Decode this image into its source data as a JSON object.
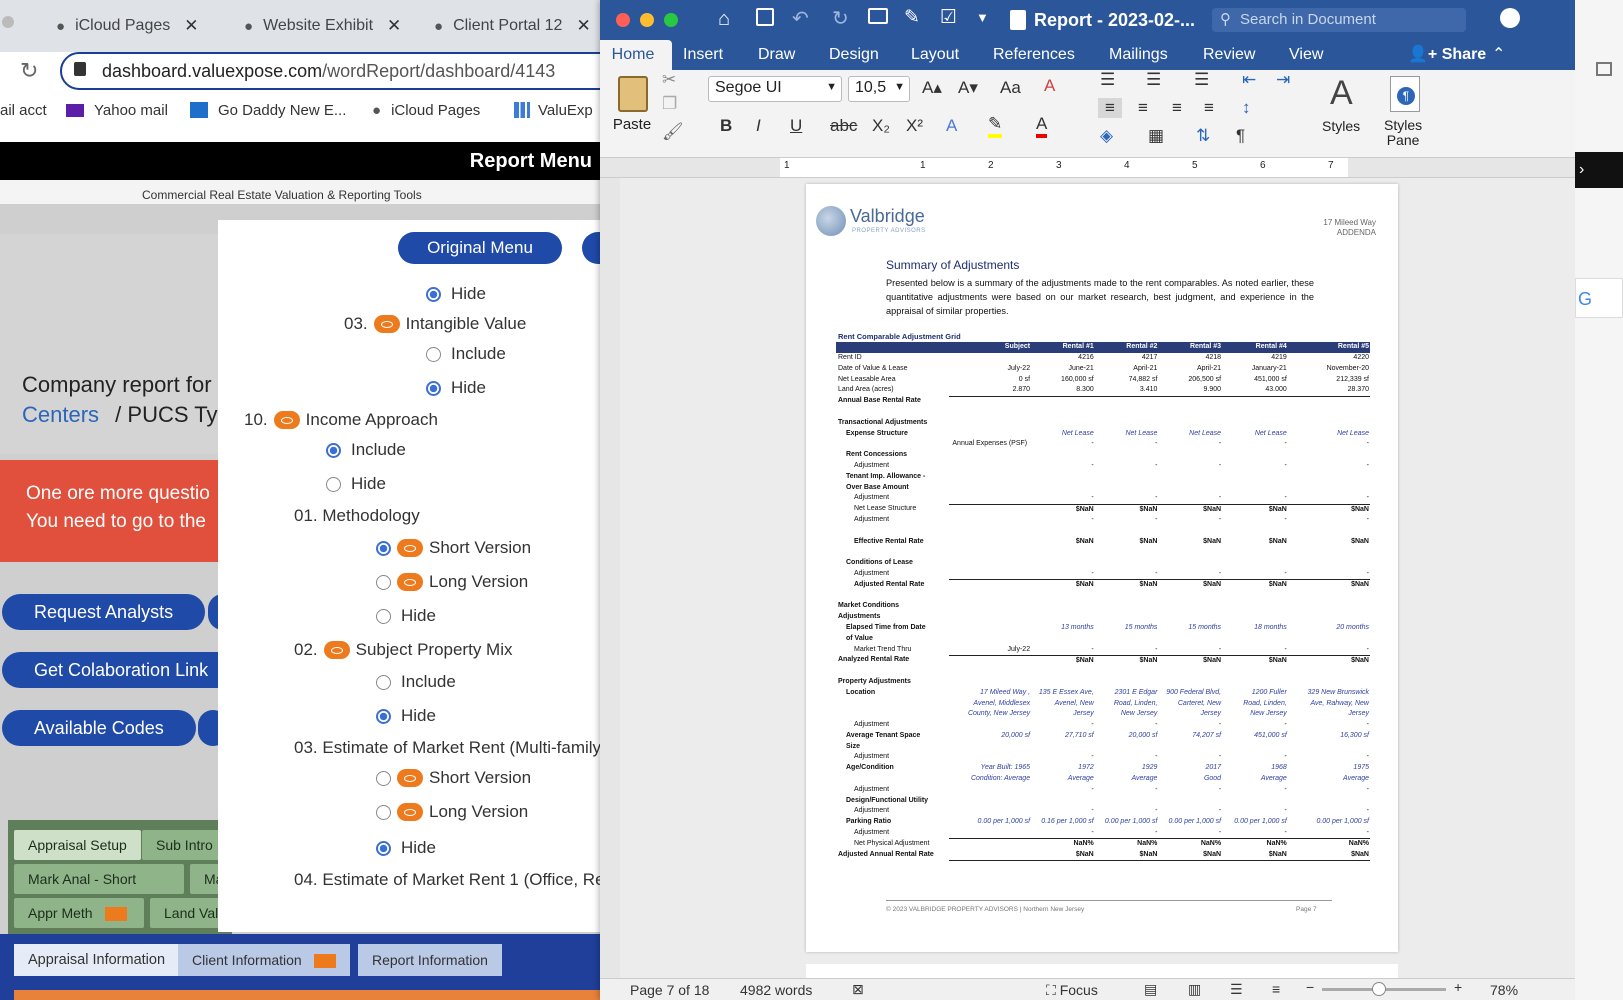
{
  "browser": {
    "tabs": [
      {
        "title": "iCloud Pages"
      },
      {
        "title": "Website Exhibit"
      },
      {
        "title": "Client Portal 12"
      }
    ],
    "url_host": "dashboard.valuexpose.com",
    "url_path": "/wordReport/dashboard/4143",
    "bookmarks": [
      "ail acct",
      "Yahoo mail",
      "Go Daddy New E...",
      "iCloud Pages",
      "ValuExp"
    ],
    "report_menu": "Report Menu",
    "tagline": "Commercial Real Estate Valuation & Reporting Tools",
    "company_line1": "Company report for",
    "company_line2a": "Centers",
    "company_line2b": "/  PUCS Ty",
    "alert_line1": "One ore more questio",
    "alert_line2": "You need to go to the",
    "buttons": [
      "Request Analysts",
      "Get Colaboration Link",
      "Available Codes"
    ],
    "original_menu": "Original Menu",
    "menu": {
      "hide": "Hide",
      "include": "Include",
      "i03": "03.",
      "intangible": "Intangible Value",
      "i10": "10.",
      "income": "Income Approach",
      "methodology": "01. Methodology",
      "short": "Short Version",
      "long": "Long Version",
      "spm": "Subject Property Mix",
      "i02": "02.",
      "emr": "03. Estimate of Market Rent (Multi-family)",
      "emr1": "04. Estimate of Market Rent 1 (Office, Retail"
    },
    "bottom_tabs": {
      "row1": [
        "Appraisal Setup",
        "Sub Intro"
      ],
      "row2": [
        "Mark Anal - Short",
        "Ma"
      ],
      "row3": [
        "Appr Meth",
        "Land Val"
      ],
      "row4": [
        "Appraisal Information",
        "Client Information",
        "Report Information"
      ]
    }
  },
  "word": {
    "doc_title": "Report - 2023-02-...",
    "search_placeholder": "Search in Document",
    "tabs": [
      "Home",
      "Insert",
      "Draw",
      "Design",
      "Layout",
      "References",
      "Mailings",
      "Review",
      "View"
    ],
    "share": "Share",
    "paste": "Paste",
    "font": "Segoe UI",
    "font_size": "10,5",
    "styles": "Styles",
    "styles_pane1": "Styles",
    "styles_pane2": "Pane",
    "ruler_marks": [
      "1",
      "1",
      "2",
      "3",
      "4",
      "5",
      "6",
      "7"
    ],
    "status": {
      "page": "Page 7 of 18",
      "words": "4982 words",
      "focus": "Focus",
      "zoom": "78%"
    },
    "page": {
      "logo": "Valbridge",
      "logo_sub": "PROPERTY ADVISORS",
      "header_addr": "17 Mileed Way",
      "header_sec": "ADDENDA",
      "heading": "Summary of Adjustments",
      "intro": "Presented below is a summary of the adjustments made to the rent comparables. As noted earlier, these quantitative adjustments were based on our market research, best judgment, and experience in the appraisal of similar properties.",
      "grid_title": "Rent Comparable Adjustment Grid",
      "footer_left": "© 2023 VALBRIDGE PROPERTY ADVISORS | Northern New Jersey",
      "footer_right": "Page 7",
      "grid": {
        "header": [
          "",
          "Subject",
          "Rental #1",
          "Rental #2",
          "Rental #3",
          "Rental #4",
          "Rental #5"
        ],
        "rows": [
          {
            "label": "Rent ID",
            "c": [
              "",
              "4216",
              "4217",
              "4218",
              "4219",
              "4220"
            ]
          },
          {
            "label": "Date of Value & Lease",
            "c": [
              "July-22",
              "June-21",
              "April-21",
              "April-21",
              "January-21",
              "November-20"
            ]
          },
          {
            "label": "Net Leasable Area",
            "c": [
              "0 sf",
              "160,000 sf",
              "74,882 sf",
              "206,500 sf",
              "451,000 sf",
              "212,339 sf"
            ]
          },
          {
            "label": "Land Area (acres)",
            "c": [
              "2.870",
              "8.300",
              "3.410",
              "9.900",
              "43.000",
              "28.370"
            ],
            "ul": true
          },
          {
            "label": "Annual Base Rental Rate",
            "c": [
              "",
              "",
              "",
              "",
              "",
              ""
            ],
            "bold": true
          },
          {
            "label": "",
            "c": [
              "",
              "",
              "",
              "",
              "",
              ""
            ]
          },
          {
            "label": "Transactional Adjustments",
            "c": [
              "",
              "",
              "",
              "",
              "",
              ""
            ],
            "bold": true
          },
          {
            "label": "Expense Structure",
            "c": [
              "",
              "Net Lease",
              "Net Lease",
              "Net Lease",
              "Net Lease",
              "Net Lease"
            ],
            "bold": true,
            "ind": 1,
            "it": true
          },
          {
            "label": "Annual Expenses (PSF)",
            "c": [
              "",
              "-",
              "-",
              "-",
              "-",
              "-"
            ],
            "right": true
          },
          {
            "label": "Rent Concessions",
            "c": [
              "",
              "",
              "",
              "",
              "",
              ""
            ],
            "bold": true,
            "ind": 1
          },
          {
            "label": "Adjustment",
            "c": [
              "",
              "-",
              "-",
              "-",
              "-",
              "-"
            ],
            "ind": 2
          },
          {
            "label": "Tenant Imp. Allowance -",
            "c": [
              "",
              "",
              "",
              "",
              "",
              ""
            ],
            "bold": true,
            "ind": 1
          },
          {
            "label": "Over Base Amount",
            "c": [
              "",
              "",
              "",
              "",
              "",
              ""
            ],
            "bold": true,
            "ind": 1
          },
          {
            "label": "Adjustment",
            "c": [
              "",
              "-",
              "-",
              "-",
              "-",
              "-"
            ],
            "ind": 2,
            "ul": true
          },
          {
            "label": "Net Lease Structure",
            "c": [
              "",
              "$NaN",
              "$NaN",
              "$NaN",
              "$NaN",
              "$NaN"
            ],
            "ind": 2
          },
          {
            "label": "Adjustment",
            "c": [
              "",
              "-",
              "-",
              "-",
              "-",
              "-"
            ],
            "ind": 2
          },
          {
            "label": "",
            "c": [
              "",
              "",
              "",
              "",
              "",
              ""
            ]
          },
          {
            "label": "Effective Rental Rate",
            "c": [
              "",
              "$NaN",
              "$NaN",
              "$NaN",
              "$NaN",
              "$NaN"
            ],
            "bold": true,
            "ind": 2
          },
          {
            "label": "",
            "c": [
              "",
              "",
              "",
              "",
              "",
              ""
            ]
          },
          {
            "label": "Conditions of Lease",
            "c": [
              "",
              "",
              "",
              "",
              "",
              ""
            ],
            "bold": true,
            "ind": 1
          },
          {
            "label": "Adjustment",
            "c": [
              "",
              "-",
              "-",
              "-",
              "-",
              "-"
            ],
            "ind": 2,
            "ul": true
          },
          {
            "label": "Adjusted Rental Rate",
            "c": [
              "",
              "$NaN",
              "$NaN",
              "$NaN",
              "$NaN",
              "$NaN"
            ],
            "bold": true,
            "ind": 2
          },
          {
            "label": "",
            "c": [
              "",
              "",
              "",
              "",
              "",
              ""
            ]
          },
          {
            "label": "Market Conditions",
            "c": [
              "",
              "",
              "",
              "",
              "",
              ""
            ],
            "bold": true
          },
          {
            "label": "Adjustments",
            "c": [
              "",
              "",
              "",
              "",
              "",
              ""
            ],
            "bold": true
          },
          {
            "label": "Elapsed Time from Date",
            "c": [
              "",
              "13 months",
              "15 months",
              "15 months",
              "18 months",
              "20 months"
            ],
            "bold": true,
            "ind": 1,
            "it": true
          },
          {
            "label": "of Value",
            "c": [
              "",
              "",
              "",
              "",
              "",
              ""
            ],
            "bold": true,
            "ind": 1
          },
          {
            "label": "Market Trend Thru",
            "c": [
              "July-22",
              "-",
              "-",
              "-",
              "-",
              "-"
            ],
            "ind": 2,
            "ul": true
          },
          {
            "label": "Analyzed Rental Rate",
            "c": [
              "",
              "$NaN",
              "$NaN",
              "$NaN",
              "$NaN",
              "$NaN"
            ],
            "bold": true
          },
          {
            "label": "",
            "c": [
              "",
              "",
              "",
              "",
              "",
              ""
            ]
          },
          {
            "label": "Property Adjustments",
            "c": [
              "",
              "",
              "",
              "",
              "",
              ""
            ],
            "bold": true
          },
          {
            "label": "Location",
            "c": [
              "17 Mileed Way ,",
              "135 E Essex Ave,",
              "2301 E Edgar",
              "900 Federal Blvd,",
              "1200 Fuller",
              "329 New Brunswick"
            ],
            "bold": true,
            "ind": 1,
            "it": true
          },
          {
            "label": "",
            "c": [
              "Avenel, Middlesex",
              "Avenel, New",
              "Road, Linden,",
              "Carteret, New",
              "Road, Linden,",
              "Ave, Rahway, New"
            ],
            "it": true
          },
          {
            "label": "",
            "c": [
              "County, New Jersey",
              "Jersey",
              "New Jersey",
              "Jersey",
              "New Jersey",
              "Jersey"
            ],
            "it": true
          },
          {
            "label": "Adjustment",
            "c": [
              "",
              "-",
              "-",
              "-",
              "-",
              "-"
            ],
            "ind": 2
          },
          {
            "label": "Average Tenant Space",
            "c": [
              "20,000 sf",
              "27,710 sf",
              "20,000 sf",
              "74,207 sf",
              "451,000 sf",
              "16,300 sf"
            ],
            "bold": true,
            "ind": 1,
            "it": true
          },
          {
            "label": "Size",
            "c": [
              "",
              "",
              "",
              "",
              "",
              ""
            ],
            "bold": true,
            "ind": 1
          },
          {
            "label": "Adjustment",
            "c": [
              "",
              "-",
              "-",
              "-",
              "-",
              "-"
            ],
            "ind": 2
          },
          {
            "label": "Age/Condition",
            "c": [
              "Year Built: 1965",
              "1972",
              "1929",
              "2017",
              "1968",
              "1975"
            ],
            "bold": true,
            "ind": 1,
            "it": true
          },
          {
            "label": "",
            "c": [
              "Condition: Average",
              "Average",
              "Average",
              "Good",
              "Average",
              "Average"
            ],
            "it": true
          },
          {
            "label": "Adjustment",
            "c": [
              "",
              "-",
              "-",
              "-",
              "-",
              "-"
            ],
            "ind": 2
          },
          {
            "label": "Design/Functional Utility",
            "c": [
              "",
              "",
              "",
              "",
              "",
              ""
            ],
            "bold": true,
            "ind": 1
          },
          {
            "label": "Adjustment",
            "c": [
              "",
              "-",
              "-",
              "-",
              "-",
              "-"
            ],
            "ind": 2
          },
          {
            "label": "Parking Ratio",
            "c": [
              "0.00 per 1,000 sf",
              "0.16 per 1,000 sf",
              "0.00 per 1,000 sf",
              "0.00 per 1,000 sf",
              "0.00 per 1,000 sf",
              "0.00 per 1,000 sf"
            ],
            "bold": true,
            "ind": 1,
            "it": true
          },
          {
            "label": "Adjustment",
            "c": [
              "",
              "-",
              "-",
              "-",
              "-",
              "-"
            ],
            "ind": 2,
            "ul": true
          },
          {
            "label": "Net Physical Adjustment",
            "c": [
              "",
              "NaN%",
              "NaN%",
              "NaN%",
              "NaN%",
              "NaN%"
            ],
            "ind": 2
          },
          {
            "label": "Adjusted Annual Rental Rate",
            "c": [
              "",
              "$NaN",
              "$NaN",
              "$NaN",
              "$NaN",
              "$NaN"
            ],
            "bold": true,
            "ul": true
          }
        ]
      }
    }
  }
}
